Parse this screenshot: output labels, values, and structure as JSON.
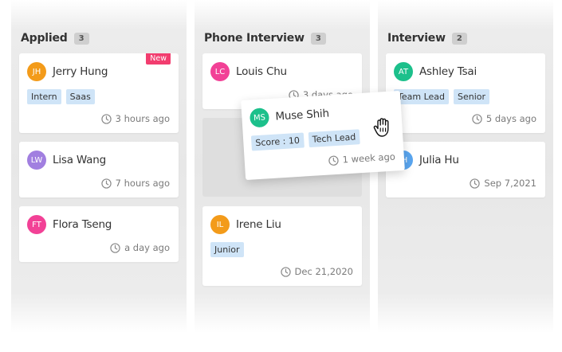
{
  "columns": [
    {
      "title": "Applied",
      "count": "3",
      "cards": [
        {
          "initials": "JH",
          "name": "Jerry Hung",
          "avatar_color": "#f39b1a",
          "tags": [
            "Intern",
            "Saas"
          ],
          "time": "3 hours ago",
          "badge": "New"
        },
        {
          "initials": "LW",
          "name": "Lisa Wang",
          "avatar_color": "#a17fe0",
          "tags": [],
          "time": "7 hours ago"
        },
        {
          "initials": "FT",
          "name": "Flora Tseng",
          "avatar_color": "#f24196",
          "tags": [],
          "time": "a day ago"
        }
      ]
    },
    {
      "title": "Phone Interview",
      "count": "3",
      "cards": [
        {
          "initials": "LC",
          "name": "Louis Chu",
          "avatar_color": "#f24196",
          "tags": [],
          "time": "3 days ago"
        },
        {
          "initials": "IL",
          "name": "Irene Liu",
          "avatar_color": "#f39b1a",
          "tags": [
            "Junior"
          ],
          "time": "Dec 21,2020"
        }
      ]
    },
    {
      "title": "Interview",
      "count": "2",
      "cards": [
        {
          "initials": "AT",
          "name": "Ashley Tsai",
          "avatar_color": "#1cc08b",
          "tags": [
            "Team Lead",
            "Senior"
          ],
          "time": "5 days ago"
        },
        {
          "initials": "JH",
          "name": "Julia Hu",
          "avatar_color": "#5aa6f0",
          "tags": [],
          "time": "Sep 7,2021"
        }
      ]
    }
  ],
  "dragging_card": {
    "initials": "MS",
    "name": "Muse Shih",
    "avatar_color": "#1cc08b",
    "tags": [
      "Score : 10",
      "Tech Lead"
    ],
    "time": "1 week ago"
  },
  "icons": {
    "time": "clock-icon",
    "cursor": "grab-hand-icon"
  }
}
